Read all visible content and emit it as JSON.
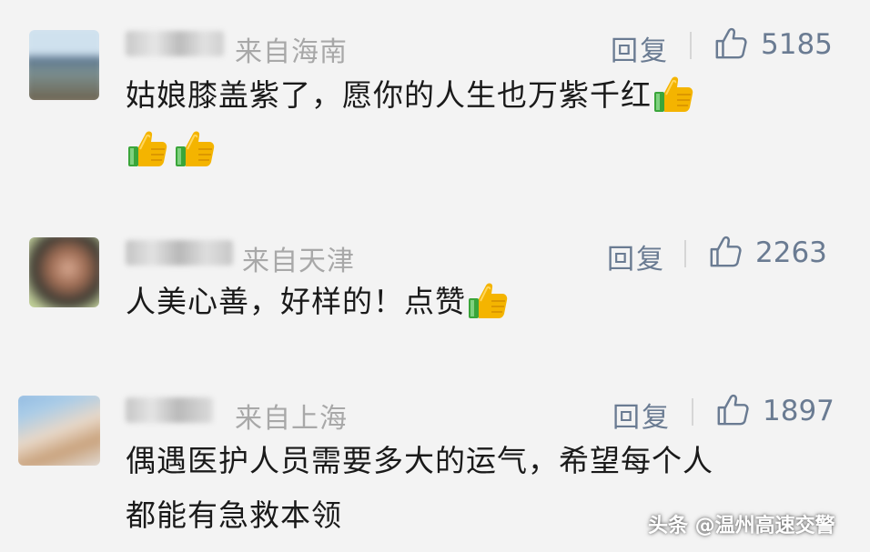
{
  "comments": [
    {
      "location": "来自海南",
      "reply_label": "回复",
      "like_count": "5185",
      "text": "姑娘膝盖紫了，愿你的人生也万紫千红",
      "trailing_emoji": [
        "thumbs-up",
        "thumbs-up",
        "thumbs-up"
      ]
    },
    {
      "location": "来自天津",
      "reply_label": "回复",
      "like_count": "2263",
      "text": "人美心善，好样的！点赞",
      "trailing_emoji": [
        "thumbs-up"
      ]
    },
    {
      "location": "来自上海",
      "reply_label": "回复",
      "like_count": "1897",
      "text_line1": "偶遇医护人员需要多大的运气，希望每个人",
      "text_line2": "都能有急救本领"
    }
  ],
  "watermark": "头条 @温州高速交警",
  "colors": {
    "background": "#f3f3f3",
    "meta_text": "#a8a8a8",
    "action_text": "#6a7b92",
    "body_text": "#1a1a1a"
  }
}
